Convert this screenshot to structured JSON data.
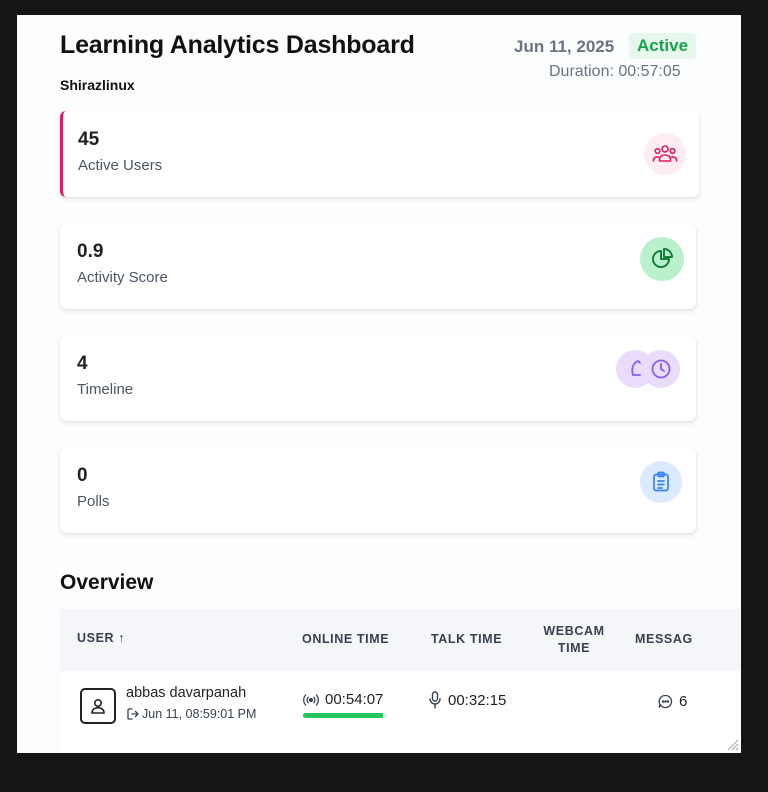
{
  "header": {
    "title": "Learning Analytics Dashboard",
    "subtitle": "Shirazlinux",
    "date": "Jun 11, 2025",
    "status": "Active",
    "duration": "Duration: 00:57:05"
  },
  "cards": [
    {
      "value": "45",
      "label": "Active Users",
      "icon": "users-icon",
      "color": "#e11d5c"
    },
    {
      "value": "0.9",
      "label": "Activity Score",
      "icon": "pie-chart-icon",
      "color": "#16a34a"
    },
    {
      "value": "4",
      "label": "Timeline",
      "icon": "clock-icon",
      "color": "#8b5cf6"
    },
    {
      "value": "0",
      "label": "Polls",
      "icon": "clipboard-icon",
      "color": "#3b82f6"
    }
  ],
  "overview": {
    "title": "Overview",
    "columns": {
      "user": "USER ↑",
      "online_time": "ONLINE TIME",
      "talk_time": "TALK TIME",
      "webcam_time": "WEBCAM TIME",
      "messages": "MESSAG"
    },
    "rows": [
      {
        "name": "abbas davarpanah",
        "joined": "Jun 11, 08:59:01 PM",
        "online_time": "00:54:07",
        "online_fraction": 0.95,
        "talk_time": "00:32:15",
        "webcam_time": "",
        "messages": "6"
      }
    ]
  }
}
